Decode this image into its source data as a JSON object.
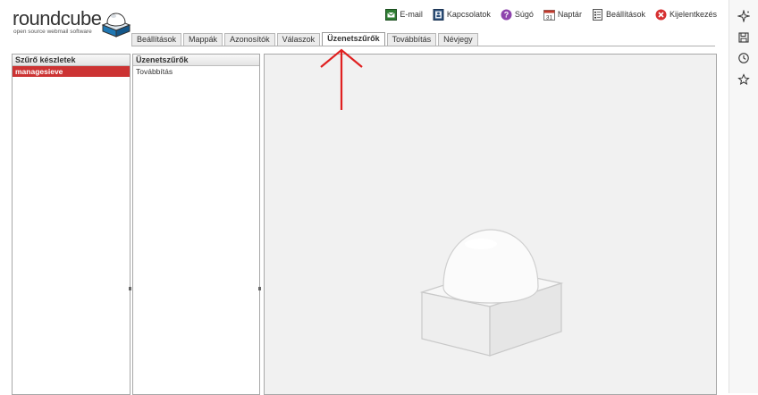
{
  "logo": {
    "wordmark": "roundcube",
    "tagline": "open source webmail software"
  },
  "topnav": [
    {
      "label": "E-mail",
      "icon": "mail-icon"
    },
    {
      "label": "Kapcsolatok",
      "icon": "contacts-icon"
    },
    {
      "label": "Súgó",
      "icon": "help-icon"
    },
    {
      "label": "Naptár",
      "icon": "calendar-icon",
      "day": "31"
    },
    {
      "label": "Beállítások",
      "icon": "settings-icon"
    },
    {
      "label": "Kijelentkezés",
      "icon": "logout-icon"
    }
  ],
  "tabs": [
    {
      "label": "Beállítások"
    },
    {
      "label": "Mappák"
    },
    {
      "label": "Azonosítók"
    },
    {
      "label": "Válaszok"
    },
    {
      "label": "Üzenetszűrők",
      "active": true
    },
    {
      "label": "Továbbítás"
    },
    {
      "label": "Névjegy"
    }
  ],
  "filtersets": {
    "title": "Szűrő készletek",
    "items": [
      "managesieve"
    ]
  },
  "filters": {
    "title": "Üzenetszűrők",
    "items": [
      "Továbbítás"
    ]
  },
  "colors": {
    "selected": "#cc3333",
    "arrow": "#e02020",
    "preview_bg": "#f1f1f1"
  },
  "sidebar": [
    "sparkle-icon",
    "save-icon",
    "history-icon",
    "star-icon"
  ]
}
